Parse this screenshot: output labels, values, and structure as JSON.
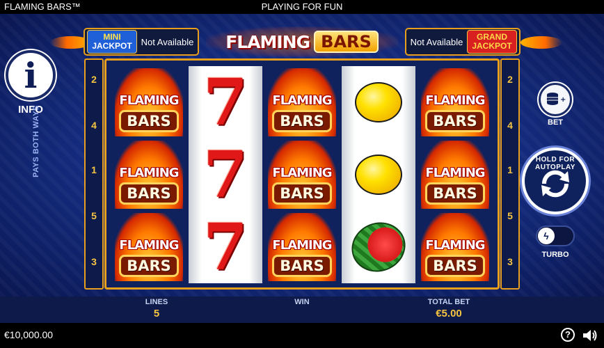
{
  "topbar": {
    "game_title": "FLAMING BARS™",
    "mode": "PLAYING FOR FUN"
  },
  "jackpots": {
    "mini": {
      "line1": "MINI",
      "line2": "JACKPOT",
      "status": "Not Available"
    },
    "grand": {
      "line1": "GRAND",
      "line2": "JACKPOT",
      "status": "Not Available"
    }
  },
  "logo": {
    "word1": "FLAMING",
    "word2": "BARS"
  },
  "info": {
    "label": "INFO",
    "glyph": "i"
  },
  "paylines": {
    "left": [
      "2",
      "4",
      "1",
      "5",
      "3"
    ],
    "right": [
      "2",
      "4",
      "1",
      "5",
      "3"
    ],
    "side_label": "PAYS BOTH WAYS"
  },
  "symbols": {
    "flaming_top": "FLAMING",
    "flaming_bottom": "BARS",
    "seven": "7"
  },
  "reels": [
    [
      "flaming-bars",
      "flaming-bars",
      "flaming-bars"
    ],
    [
      "seven",
      "seven",
      "seven"
    ],
    [
      "flaming-bars",
      "flaming-bars",
      "flaming-bars"
    ],
    [
      "lemon",
      "lemon",
      "watermelon"
    ],
    [
      "flaming-bars",
      "flaming-bars",
      "flaming-bars"
    ]
  ],
  "controls": {
    "bet_label": "BET",
    "spin_label": "HOLD FOR AUTOPLAY",
    "turbo_label": "TURBO"
  },
  "stats": {
    "lines_label": "LINES",
    "lines_value": "5",
    "win_label": "WIN",
    "win_value": "",
    "total_bet_label": "TOTAL BET",
    "total_bet_value": "€5.00"
  },
  "footer": {
    "balance": "€10,000.00"
  }
}
